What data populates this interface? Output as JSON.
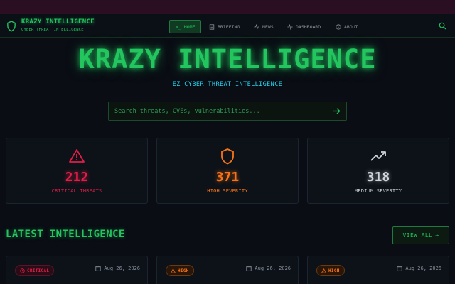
{
  "brand": {
    "title": "KRAZY INTELLIGENCE",
    "subtitle": "CYBER THREAT INTELLIGENCE"
  },
  "nav": {
    "items": [
      {
        "label": "HOME",
        "prefix": ">_",
        "active": true
      },
      {
        "label": "BRIEFING"
      },
      {
        "label": "NEWS"
      },
      {
        "label": "DASHBOARD"
      },
      {
        "label": "ABOUT"
      }
    ]
  },
  "hero": {
    "title": "KRAZY INTELLIGENCE",
    "subtitle": "EZ CYBER THREAT INTELLIGENCE"
  },
  "search": {
    "placeholder": "Search threats, CVEs, vulnerabilities..."
  },
  "stats": [
    {
      "value": "212",
      "label": "CRITICAL THREATS",
      "color": "#e11d48",
      "icon": "warning-triangle-icon"
    },
    {
      "value": "371",
      "label": "HIGH SEVERITY",
      "color": "#f97316",
      "icon": "shield-icon"
    },
    {
      "value": "318",
      "label": "MEDIUM SEVERITY",
      "color": "#d1d5db",
      "icon": "trending-up-icon"
    }
  ],
  "latest": {
    "title": "LATEST INTELLIGENCE",
    "view_all": "VIEW ALL",
    "cards": [
      {
        "badge": "CRITICAL",
        "date": "Aug 26, 2026"
      },
      {
        "badge": "HIGH",
        "date": "Aug 26, 2026"
      },
      {
        "badge": "HIGH",
        "date": "Aug 26, 2026"
      }
    ]
  },
  "colors": {
    "accent": "#22c55e",
    "cyan": "#22d3ee",
    "critical": "#e11d48",
    "high": "#f97316",
    "medium": "#d1d5db",
    "background": "#0a0d14"
  }
}
